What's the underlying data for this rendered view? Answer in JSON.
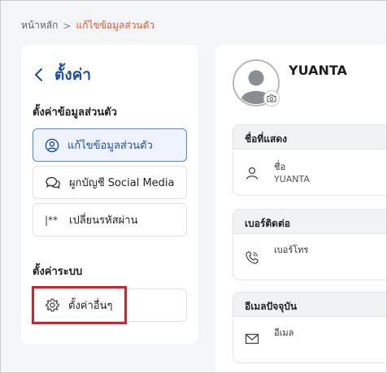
{
  "breadcrumb": {
    "home": "หน้าหลัก",
    "separator": ">",
    "current": "แก้ไขข้อมูลส่วนตัว"
  },
  "sidebar": {
    "title": "ตั้งค่า",
    "personal_section": "ตั้งค่าข้อมูลส่วนตัว",
    "items": [
      {
        "label": "แก้ไขข้อมูลส่วนตัว",
        "icon": "user-circle-icon",
        "active": true
      },
      {
        "label": "ผูกบัญชี Social Media",
        "icon": "chat-bubbles-icon",
        "active": false
      },
      {
        "label": "เปลี่ยนรหัสผ่าน",
        "icon": "password-icon",
        "icon_text": "|**",
        "active": false
      }
    ],
    "system_section": "ตั้งค่าระบบ",
    "system_items": [
      {
        "label": "ตั้งค่าอื่นๆ",
        "icon": "gear-icon",
        "highlighted": true
      }
    ]
  },
  "profile": {
    "name": "YUANTA",
    "avatar_icon": "user-silhouette-icon",
    "camera_icon": "camera-icon",
    "sections": [
      {
        "header": "ชื่อที่แสดง",
        "field_label": "ชื่อ",
        "field_value": "YUANTA",
        "icon": "user-icon"
      },
      {
        "header": "เบอร์ติดต่อ",
        "field_label": "เบอร์โทร",
        "field_value": "",
        "icon": "phone-icon"
      },
      {
        "header": "อีเมลปัจจุบัน",
        "field_label": "อีเมล",
        "field_value": "",
        "icon": "mail-icon"
      }
    ]
  },
  "colors": {
    "accent": "#1d4e9e",
    "breadcrumb_current": "#e4572e",
    "highlight": "#d1232a",
    "active_bg": "#eef3fd",
    "page_bg": "#f4f5f7"
  }
}
